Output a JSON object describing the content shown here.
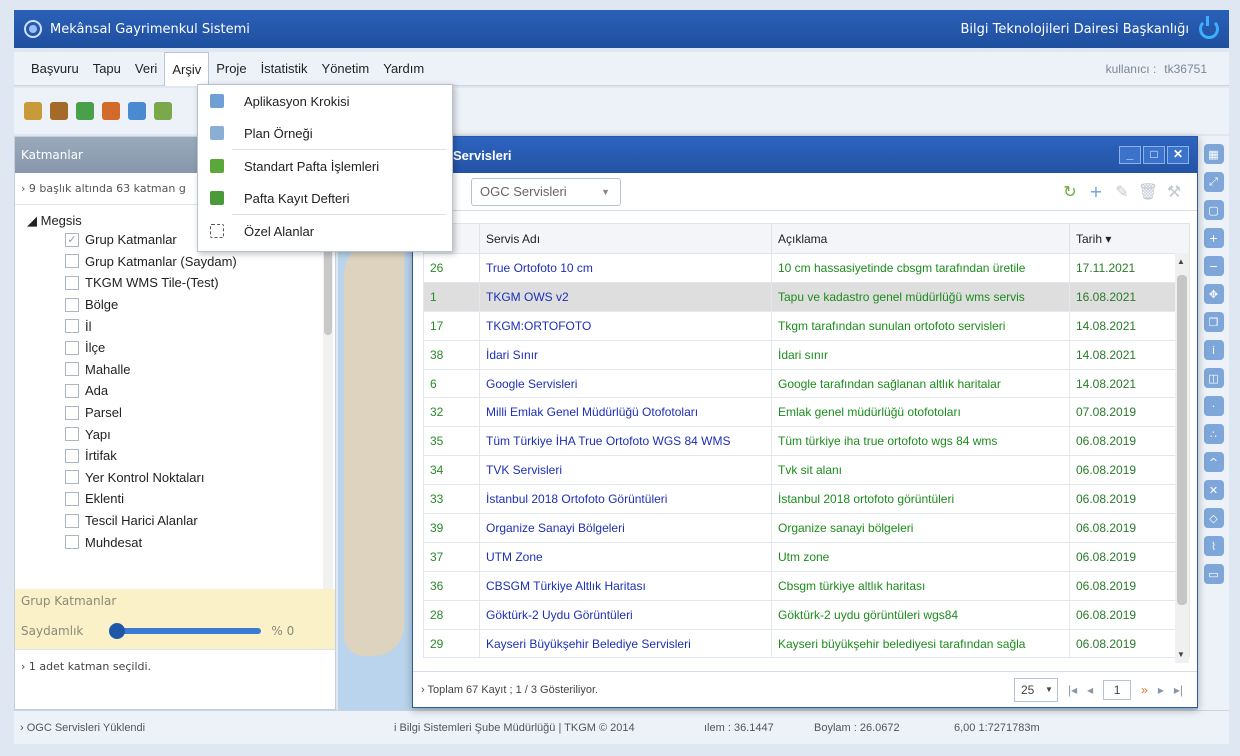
{
  "app": {
    "title": "Mekânsal Gayrimenkul Sistemi",
    "department": "Bilgi Teknolojileri Dairesi Başkanlığı"
  },
  "menu": {
    "items": [
      "Başvuru",
      "Tapu",
      "Veri",
      "Arşiv",
      "Proje",
      "İstatistik",
      "Yönetim",
      "Yardım"
    ],
    "active": "Arşiv",
    "user_label": "kullanıcı :",
    "user_value": "tk36751"
  },
  "dropdown": {
    "items": [
      {
        "label": "Aplikasyon Krokisi",
        "icon": "document-icon"
      },
      {
        "label": "Plan Örneği",
        "icon": "document-icon"
      },
      {
        "label": "Standart Pafta İşlemleri",
        "icon": "map-sheet-icon"
      },
      {
        "label": "Pafta Kayıt Defteri",
        "icon": "map-sheet-icon"
      },
      {
        "label": "Özel Alanlar",
        "icon": "dashed-box-icon"
      }
    ]
  },
  "left_panel": {
    "title": "Katmanlar",
    "info": "› 9 başlık altında 63 katman g",
    "root": "◢ Megsis",
    "layers": [
      {
        "label": "Grup Katmanlar",
        "checked": true
      },
      {
        "label": "Grup Katmanlar (Saydam)",
        "checked": false
      },
      {
        "label": "TKGM WMS Tile-(Test)",
        "checked": false
      },
      {
        "label": "Bölge",
        "checked": false
      },
      {
        "label": "İl",
        "checked": false
      },
      {
        "label": "İlçe",
        "checked": false
      },
      {
        "label": "Mahalle",
        "checked": false
      },
      {
        "label": "Ada",
        "checked": false
      },
      {
        "label": "Parsel",
        "checked": false
      },
      {
        "label": "Yapı",
        "checked": false
      },
      {
        "label": "İrtifak",
        "checked": false
      },
      {
        "label": "Yer Kontrol Noktaları",
        "checked": false
      },
      {
        "label": "Eklenti",
        "checked": false
      },
      {
        "label": "Tescil Harici Alanlar",
        "checked": false
      },
      {
        "label": "Muhdesat",
        "checked": false
      }
    ],
    "selected_group": "Grup Katmanlar",
    "opacity_label": "Saydamlık",
    "opacity_value": "% 0",
    "opacity_fraction": 0,
    "selected_count": "› 1 adet katman seçildi."
  },
  "dialog": {
    "title": "Servisleri",
    "combo_value": "OGC Servisleri",
    "columns": [
      "Servis Adı",
      "Açıklama",
      "Tarih ▾"
    ],
    "rows": [
      {
        "no": "26",
        "name": "True Ortofoto 10 cm",
        "desc": "10 cm hassasiyetinde cbsgm tarafından üretile",
        "date": "17.11.2021"
      },
      {
        "no": "1",
        "name": "TKGM OWS v2",
        "desc": "Tapu ve kadastro genel müdürlüğü wms servis",
        "date": "16.08.2021",
        "selected": true
      },
      {
        "no": "17",
        "name": "TKGM:ORTOFOTO",
        "desc": "Tkgm tarafından sunulan ortofoto servisleri",
        "date": "14.08.2021"
      },
      {
        "no": "38",
        "name": "İdari Sınır",
        "desc": "İdari sınır",
        "date": "14.08.2021"
      },
      {
        "no": "6",
        "name": "Google Servisleri",
        "desc": "Google tarafından sağlanan altlık haritalar",
        "date": "14.08.2021"
      },
      {
        "no": "32",
        "name": "Milli Emlak Genel Müdürlüğü Otofotoları",
        "desc": "Emlak genel müdürlüğü otofotoları",
        "date": "07.08.2019"
      },
      {
        "no": "35",
        "name": "Tüm Türkiye İHA True Ortofoto WGS 84 WMS",
        "desc": "Tüm türkiye iha true ortofoto wgs 84 wms",
        "date": "06.08.2019"
      },
      {
        "no": "34",
        "name": "TVK Servisleri",
        "desc": "Tvk sit alanı",
        "date": "06.08.2019"
      },
      {
        "no": "33",
        "name": "İstanbul 2018 Ortofoto Görüntüleri",
        "desc": "İstanbul 2018 ortofoto görüntüleri",
        "date": "06.08.2019"
      },
      {
        "no": "39",
        "name": "Organize Sanayi Bölgeleri",
        "desc": "Organize sanayi bölgeleri",
        "date": "06.08.2019"
      },
      {
        "no": "37",
        "name": "UTM Zone",
        "desc": "Utm zone",
        "date": "06.08.2019"
      },
      {
        "no": "36",
        "name": "CBSGM Türkiye Altlık Haritası",
        "desc": "Cbsgm türkiye altlık haritası",
        "date": "06.08.2019"
      },
      {
        "no": "28",
        "name": "Göktürk-2 Uydu Görüntüleri",
        "desc": "Göktürk-2 uydu görüntüleri wgs84",
        "date": "06.08.2019"
      },
      {
        "no": "29",
        "name": "Kayseri Büyükşehir Belediye Servisleri",
        "desc": "Kayseri büyükşehir belediyesi tarafından sağla",
        "date": "06.08.2019"
      }
    ],
    "footer_total": "› Toplam 67 Kayıt ; 1 / 3 Gösteriliyor.",
    "page_size": "25",
    "page_number": "1"
  },
  "status": {
    "left": "› OGC Servisleri Yüklendi",
    "center": "i Bilgi Sistemleri Şube Müdürlüğü | TKGM © 2014",
    "lat": "ılem : 36.1447",
    "lon": "Boylam : 26.0672",
    "scale": "6,00  1:7271783m"
  }
}
